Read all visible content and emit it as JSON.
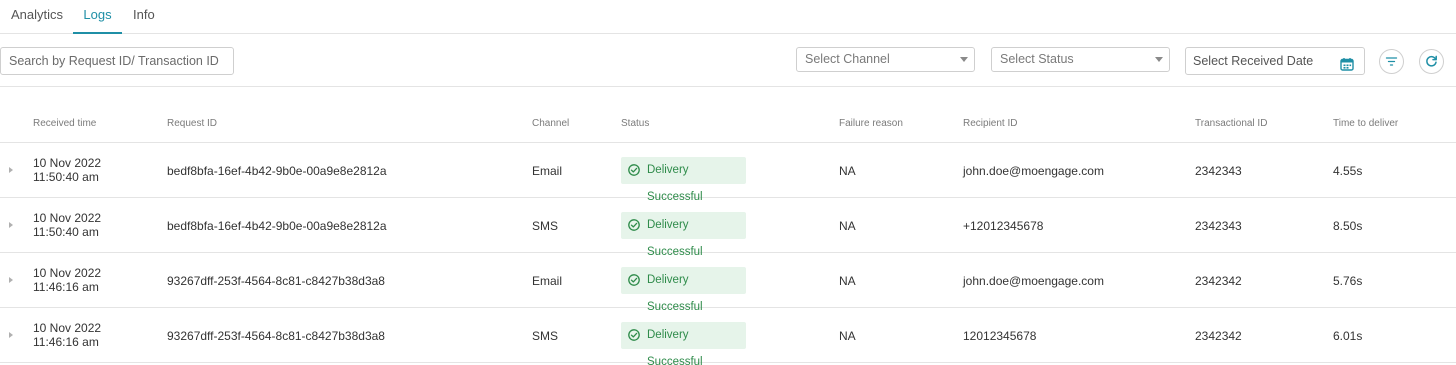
{
  "tabs": [
    {
      "label": "Analytics",
      "active": false
    },
    {
      "label": "Logs",
      "active": true
    },
    {
      "label": "Info",
      "active": false
    }
  ],
  "filters": {
    "search_placeholder": "Search by Request ID/ Transaction ID",
    "channel_placeholder": "Select Channel",
    "status_placeholder": "Select Status",
    "date_placeholder": "Select Received Date"
  },
  "table": {
    "columns": [
      "Received time",
      "Request ID",
      "Channel",
      "Status",
      "Failure reason",
      "Recipient ID",
      "Transactional ID",
      "Time to deliver"
    ],
    "rows": [
      {
        "date": "10 Nov 2022",
        "time": "11:50:40 am",
        "request_id": "bedf8bfa-16ef-4b42-9b0e-00a9e8e2812a",
        "channel": "Email",
        "status": "Delivery Successful",
        "failure_reason": "NA",
        "recipient": "john.doe@moengage.com",
        "transactional_id": "2342343",
        "time_to_deliver": "4.55s"
      },
      {
        "date": "10 Nov 2022",
        "time": "11:50:40 am",
        "request_id": "bedf8bfa-16ef-4b42-9b0e-00a9e8e2812a",
        "channel": "SMS",
        "status": "Delivery Successful",
        "failure_reason": "NA",
        "recipient": "+12012345678",
        "transactional_id": "2342343",
        "time_to_deliver": "8.50s"
      },
      {
        "date": "10 Nov 2022",
        "time": "11:46:16 am",
        "request_id": "93267dff-253f-4564-8c81-c8427b38d3a8",
        "channel": "Email",
        "status": "Delivery Successful",
        "failure_reason": "NA",
        "recipient": "john.doe@moengage.com",
        "transactional_id": "2342342",
        "time_to_deliver": "5.76s"
      },
      {
        "date": "10 Nov 2022",
        "time": "11:46:16 am",
        "request_id": "93267dff-253f-4564-8c81-c8427b38d3a8",
        "channel": "SMS",
        "status": "Delivery Successful",
        "failure_reason": "NA",
        "recipient": "12012345678",
        "transactional_id": "2342342",
        "time_to_deliver": "6.01s"
      }
    ]
  },
  "icons": {
    "calendar": "calendar-icon",
    "filter": "filter-icon",
    "refresh": "refresh-icon",
    "status_check": "check-circle-icon",
    "expand": "caret-right-icon"
  },
  "colors": {
    "accent": "#1f8fa6",
    "success_text": "#2e8b4a",
    "success_bg": "#e6f4ea",
    "border": "#e4e4e4"
  }
}
